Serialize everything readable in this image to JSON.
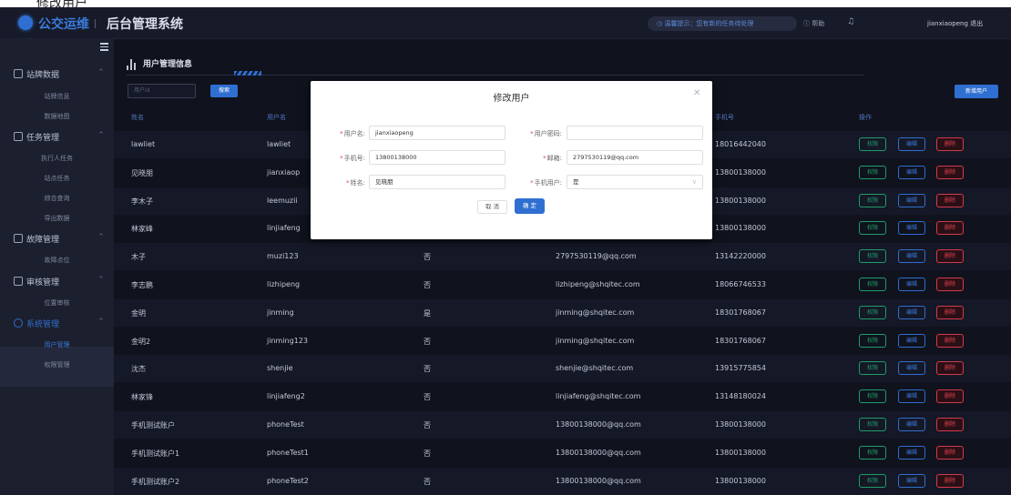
{
  "caption": "修改用户",
  "header": {
    "logo_text": "公交运维",
    "system_title": "后台管理系统",
    "notice": "温馨提示：您有新的任务待处理",
    "help": "帮助",
    "username": "jianxiaopeng",
    "logout": "退出"
  },
  "sidebar": {
    "groups": [
      {
        "label": "站牌数据",
        "items": [
          "站牌信息",
          "数据地图"
        ]
      },
      {
        "label": "任务管理",
        "items": [
          "执行人任务",
          "站点任务",
          "综合查询",
          "导出数据"
        ]
      },
      {
        "label": "故障管理",
        "items": [
          "故障点位"
        ]
      },
      {
        "label": "审核管理",
        "items": [
          "位置审核"
        ]
      },
      {
        "label": "系统管理",
        "items": [
          "用户管理",
          "权限管理"
        ]
      }
    ]
  },
  "page": {
    "title": "用户管理信息",
    "search_placeholder": "用户id",
    "search_button": "搜索",
    "new_button": "新增用户"
  },
  "table": {
    "headers": [
      "姓名",
      "用户名",
      "",
      "",
      "手机号",
      "操作"
    ],
    "rows": [
      {
        "name": "lawliet",
        "username": "lawliet",
        "phone_user": "",
        "email": "",
        "phone": "18016442040"
      },
      {
        "name": "见晓朋",
        "username": "jianxiaop",
        "phone_user": "",
        "email": "",
        "phone": "13800138000"
      },
      {
        "name": "李木子",
        "username": "leemuzii",
        "phone_user": "",
        "email": "",
        "phone": "13800138000"
      },
      {
        "name": "林家峰",
        "username": "linjiafeng",
        "phone_user": "",
        "email": "",
        "phone": "13800138000"
      },
      {
        "name": "木子",
        "username": "muzi123",
        "phone_user": "否",
        "email": "2797530119@qq.com",
        "phone": "13142220000"
      },
      {
        "name": "李志鹏",
        "username": "lizhipeng",
        "phone_user": "否",
        "email": "lizhipeng@shqitec.com",
        "phone": "18066746533"
      },
      {
        "name": "金明",
        "username": "jinming",
        "phone_user": "是",
        "email": "jinming@shqitec.com",
        "phone": "18301768067"
      },
      {
        "name": "金明2",
        "username": "jinming123",
        "phone_user": "否",
        "email": "jinming@shqitec.com",
        "phone": "18301768067"
      },
      {
        "name": "沈杰",
        "username": "shenjie",
        "phone_user": "否",
        "email": "shenjie@shqitec.com",
        "phone": "13915775854"
      },
      {
        "name": "林家锋",
        "username": "linjiafeng2",
        "phone_user": "否",
        "email": "linjiafeng@shqitec.com",
        "phone": "13148180024"
      },
      {
        "name": "手机测试账户",
        "username": "phoneTest",
        "phone_user": "否",
        "email": "13800138000@qq.com",
        "phone": "13800138000"
      },
      {
        "name": "手机测试账户1",
        "username": "phoneTest1",
        "phone_user": "否",
        "email": "13800138000@qq.com",
        "phone": "13800138000"
      },
      {
        "name": "手机测试账户2",
        "username": "phoneTest2",
        "phone_user": "否",
        "email": "13800138000@qq.com",
        "phone": "13800138000"
      }
    ],
    "actions": {
      "perm": "权限",
      "edit": "编辑",
      "delete": "删除"
    }
  },
  "modal": {
    "title": "修改用户",
    "fields": {
      "username": {
        "label": "用户名:",
        "value": "jianxiaopeng"
      },
      "password": {
        "label": "用户密码:",
        "value": ""
      },
      "phone": {
        "label": "手机号:",
        "value": "13800138000"
      },
      "email": {
        "label": "邮箱:",
        "value": "2797530119@qq.com"
      },
      "name": {
        "label": "姓名:",
        "value": "见晓朋"
      },
      "phone_user": {
        "label": "手机用户:",
        "value": "是"
      }
    },
    "cancel": "取 消",
    "confirm": "确 定"
  },
  "colors": {
    "accent": "#2f6fd1",
    "background": "#10121d",
    "success": "#1f9d6a",
    "danger": "#e0414f"
  }
}
